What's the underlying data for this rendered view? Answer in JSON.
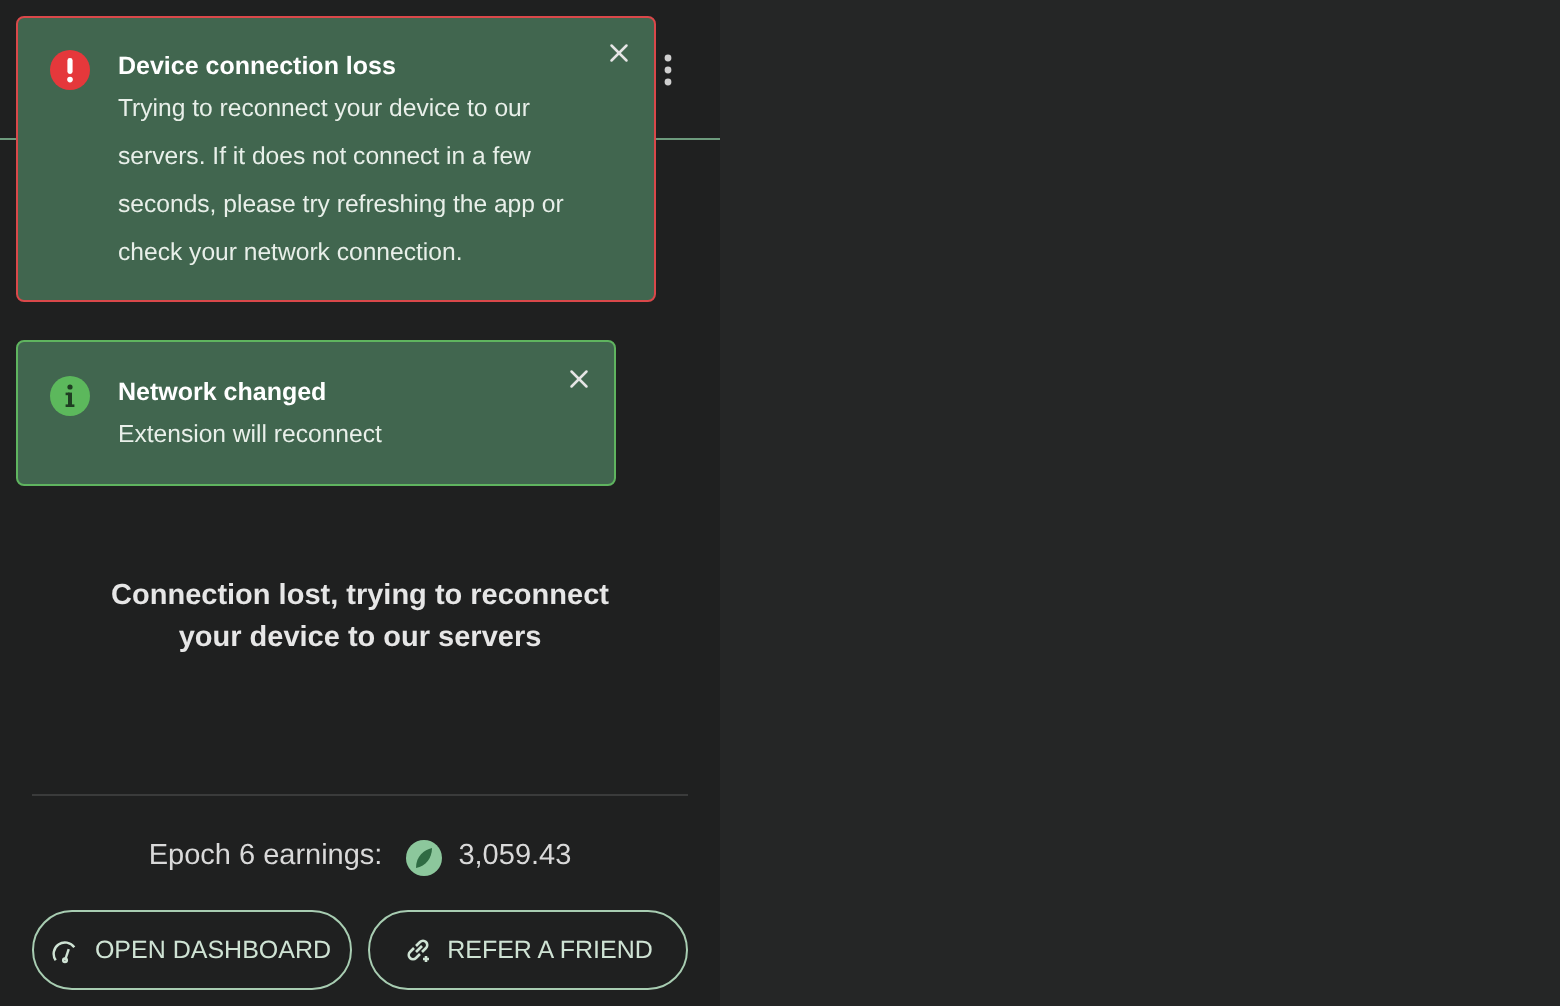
{
  "toasts": [
    {
      "kind": "error",
      "title": "Device connection loss",
      "message": "Trying to reconnect your device to our servers. If it does not connect in a few seconds, please try refreshing the app or check your network connection."
    },
    {
      "kind": "info",
      "title": "Network changed",
      "message": "Extension will reconnect"
    }
  ],
  "status_message": "Connection lost, trying to reconnect your device to our servers",
  "earnings": {
    "label": "Epoch 6 earnings:",
    "value": "3,059.43"
  },
  "buttons": [
    {
      "kind": "dashboard",
      "label": "OPEN DASHBOARD"
    },
    {
      "kind": "refer",
      "label": "REFER A FRIEND"
    }
  ]
}
